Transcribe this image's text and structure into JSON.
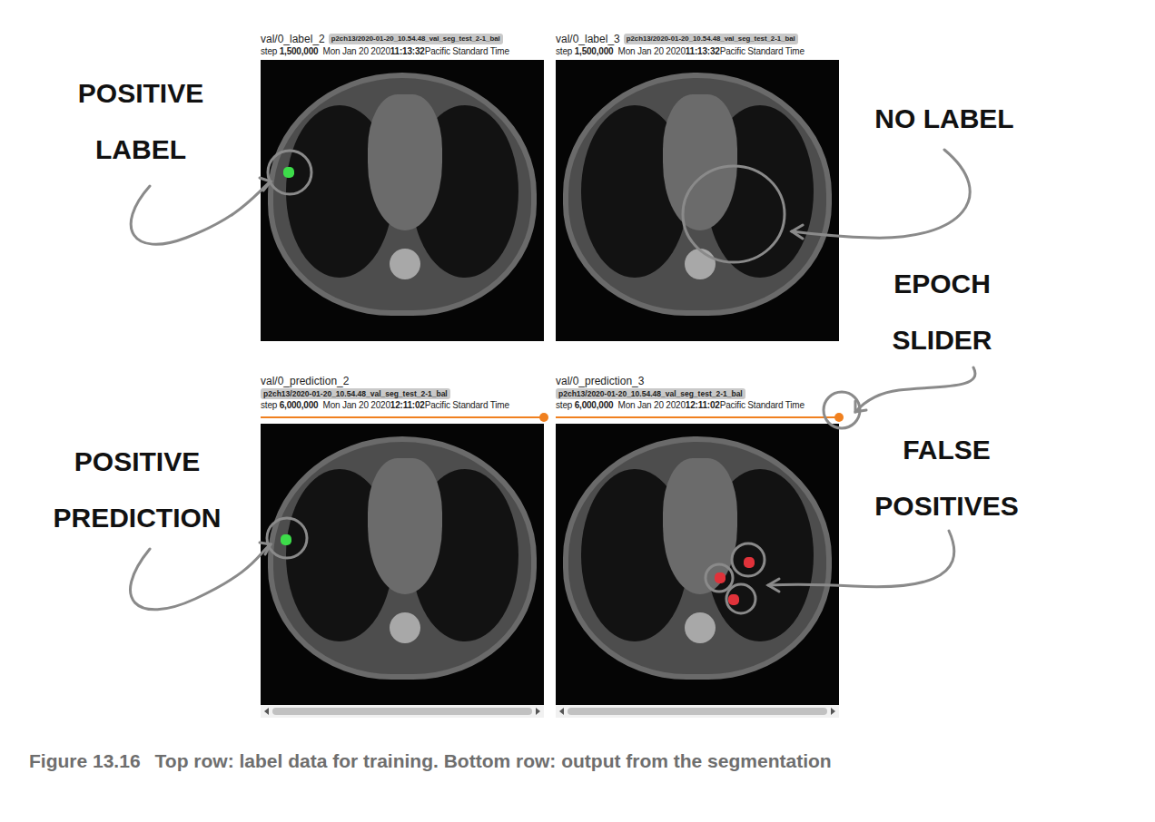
{
  "panels": [
    {
      "kind": "label",
      "title": "val/0_label_2",
      "run": "p2ch13/2020-01-20_10.54.48_val_seg_test_2-1_bal",
      "step": "1,500,000",
      "date": "Mon Jan 20 2020",
      "time": "11:13:32",
      "zone": "Pacific Standard Time",
      "marks": [
        {
          "color": "#3ddc4a"
        }
      ]
    },
    {
      "kind": "label",
      "title": "val/0_label_3",
      "run": "p2ch13/2020-01-20_10.54.48_val_seg_test_2-1_bal",
      "step": "1,500,000",
      "date": "Mon Jan 20 2020",
      "time": "11:13:32",
      "zone": "Pacific Standard Time",
      "marks": []
    },
    {
      "kind": "prediction",
      "title": "val/0_prediction_2",
      "run": "p2ch13/2020-01-20_10.54.48_val_seg_test_2-1_bal",
      "step": "6,000,000",
      "date": "Mon Jan 20 2020",
      "time": "12:11:02",
      "zone": "Pacific Standard Time",
      "level": 1,
      "marks": [
        {
          "color": "#3ddc4a"
        }
      ]
    },
    {
      "kind": "prediction",
      "title": "val/0_prediction_3",
      "run": "p2ch13/2020-01-20_10.54.48_val_seg_test_2-1_bal",
      "step": "6,000,000",
      "date": "Mon Jan 20 2020",
      "time": "12:11:02",
      "zone": "Pacific Standard Time",
      "level": 1,
      "marks": [
        {
          "color": "#e0323a"
        },
        {
          "color": "#e0323a"
        },
        {
          "color": "#e0323a"
        }
      ]
    }
  ],
  "annotations": [
    {
      "lines": [
        "POSITIVE",
        "LABEL"
      ]
    },
    {
      "lines": [
        "NO LABEL"
      ]
    },
    {
      "lines": [
        "EPOCH",
        "SLIDER"
      ]
    },
    {
      "lines": [
        "POSITIVE",
        "PREDICTION"
      ]
    },
    {
      "lines": [
        "FALSE",
        "POSITIVES"
      ]
    }
  ],
  "caption": {
    "number": "Figure 13.16",
    "text": "Top row: label data for training. Bottom row: output from the segmentation"
  }
}
